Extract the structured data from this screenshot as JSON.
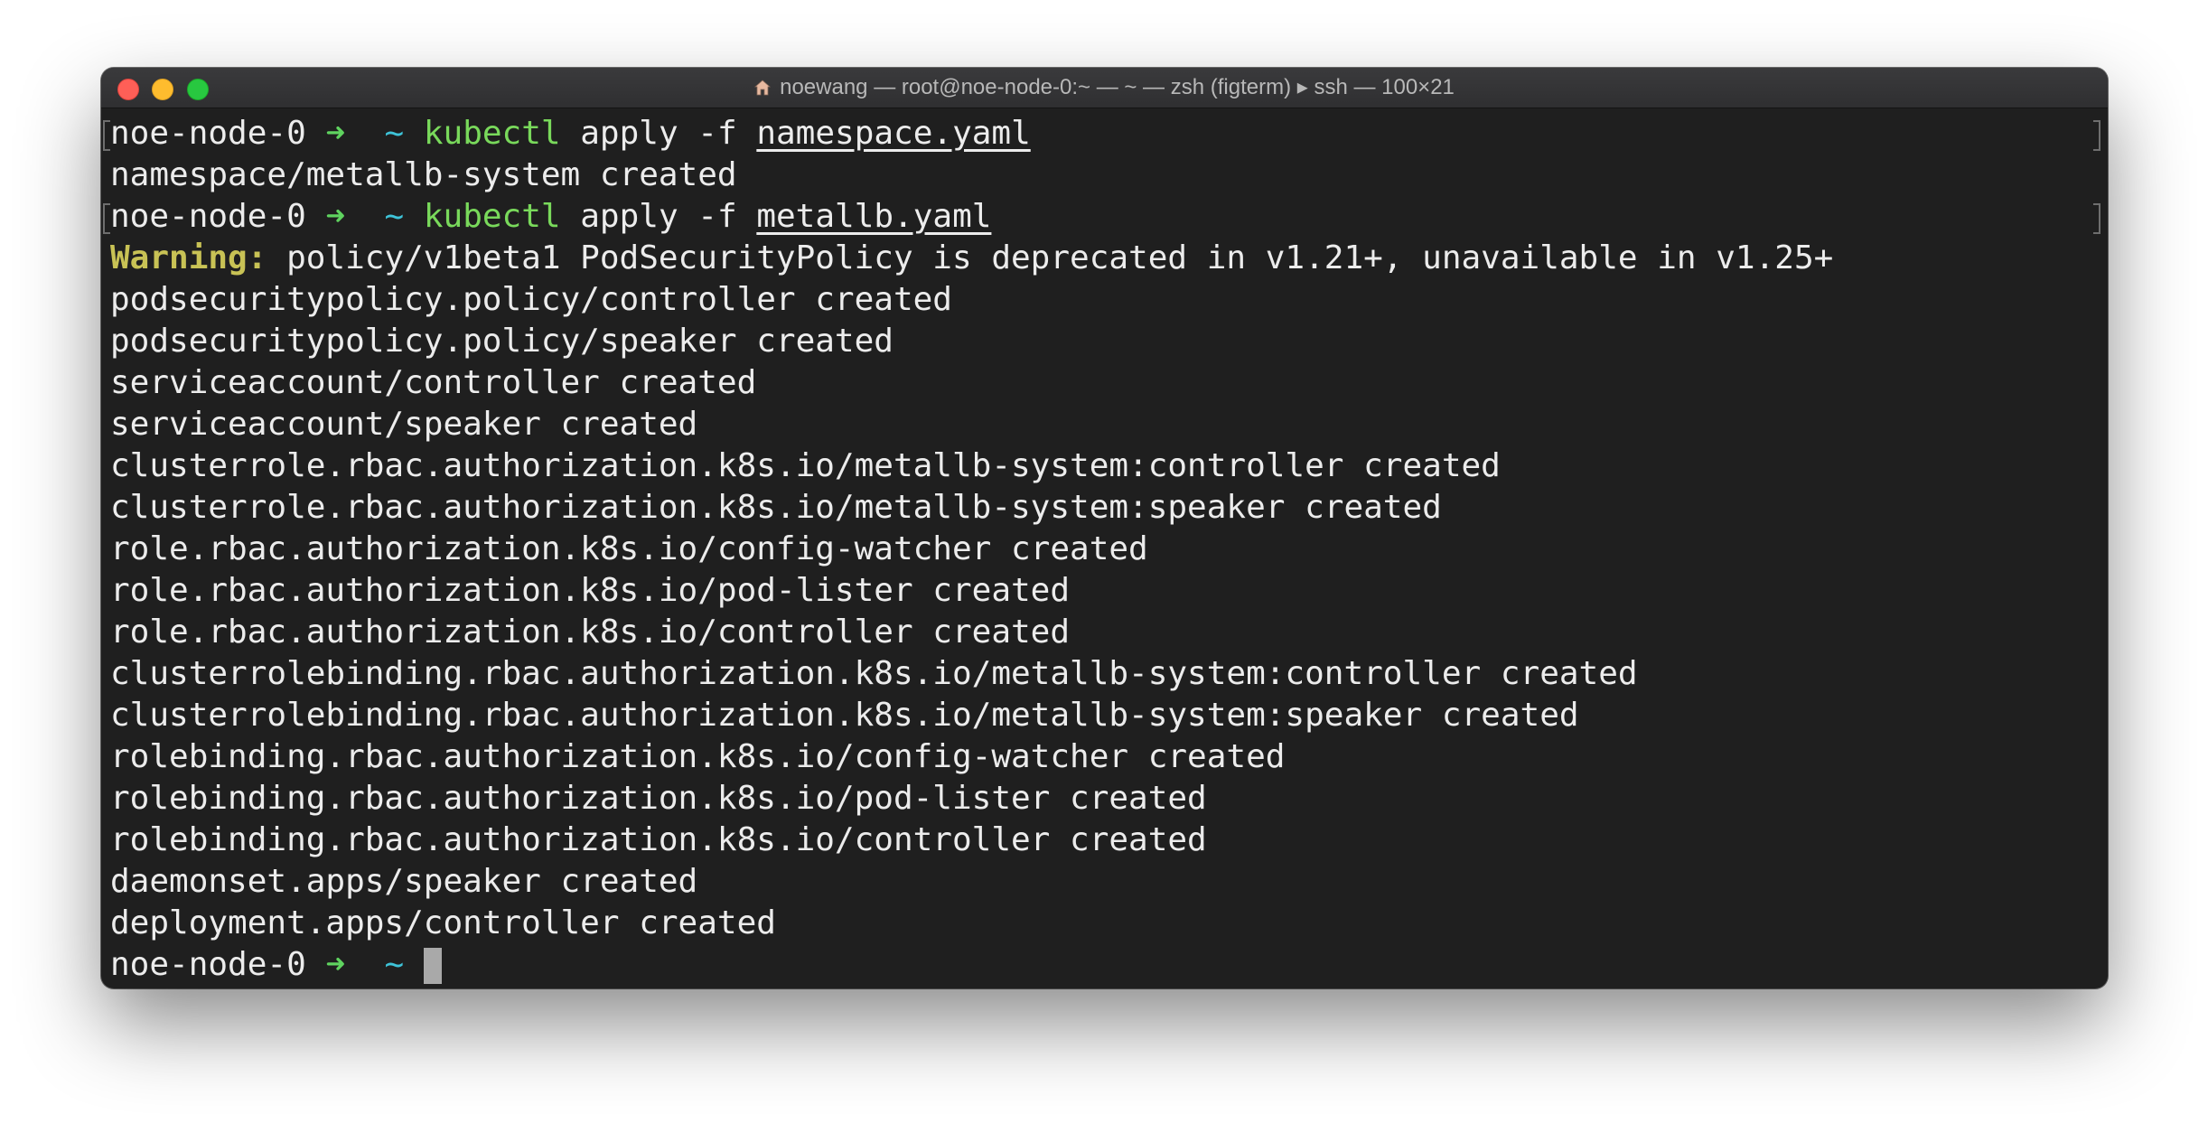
{
  "window": {
    "title": "noewang — root@noe-node-0:~ — ~ — zsh (figterm) ▸ ssh — 100×21"
  },
  "prompt": {
    "host": "noe-node-0",
    "arrow": "➜",
    "dir": "~"
  },
  "session": [
    {
      "kind": "command",
      "cmd": "kubectl",
      "args": " apply -f ",
      "file": "namespace.yaml"
    },
    {
      "kind": "output",
      "text": "namespace/metallb-system created"
    },
    {
      "kind": "command",
      "cmd": "kubectl",
      "args": " apply -f ",
      "file": "metallb.yaml"
    },
    {
      "kind": "warning",
      "label": "Warning:",
      "text": " policy/v1beta1 PodSecurityPolicy is deprecated in v1.21+, unavailable in v1.25+"
    },
    {
      "kind": "output",
      "text": "podsecuritypolicy.policy/controller created"
    },
    {
      "kind": "output",
      "text": "podsecuritypolicy.policy/speaker created"
    },
    {
      "kind": "output",
      "text": "serviceaccount/controller created"
    },
    {
      "kind": "output",
      "text": "serviceaccount/speaker created"
    },
    {
      "kind": "output",
      "text": "clusterrole.rbac.authorization.k8s.io/metallb-system:controller created"
    },
    {
      "kind": "output",
      "text": "clusterrole.rbac.authorization.k8s.io/metallb-system:speaker created"
    },
    {
      "kind": "output",
      "text": "role.rbac.authorization.k8s.io/config-watcher created"
    },
    {
      "kind": "output",
      "text": "role.rbac.authorization.k8s.io/pod-lister created"
    },
    {
      "kind": "output",
      "text": "role.rbac.authorization.k8s.io/controller created"
    },
    {
      "kind": "output",
      "text": "clusterrolebinding.rbac.authorization.k8s.io/metallb-system:controller created"
    },
    {
      "kind": "output",
      "text": "clusterrolebinding.rbac.authorization.k8s.io/metallb-system:speaker created"
    },
    {
      "kind": "output",
      "text": "rolebinding.rbac.authorization.k8s.io/config-watcher created"
    },
    {
      "kind": "output",
      "text": "rolebinding.rbac.authorization.k8s.io/pod-lister created"
    },
    {
      "kind": "output",
      "text": "rolebinding.rbac.authorization.k8s.io/controller created"
    },
    {
      "kind": "output",
      "text": "daemonset.apps/speaker created"
    },
    {
      "kind": "output",
      "text": "deployment.apps/controller created"
    },
    {
      "kind": "prompt"
    }
  ],
  "colors": {
    "background": "#1f1f1f",
    "text": "#ececec",
    "arrow": "#5fd35f",
    "tilde": "#3ec3d8",
    "command": "#79d95b",
    "warning": "#c8c255"
  }
}
